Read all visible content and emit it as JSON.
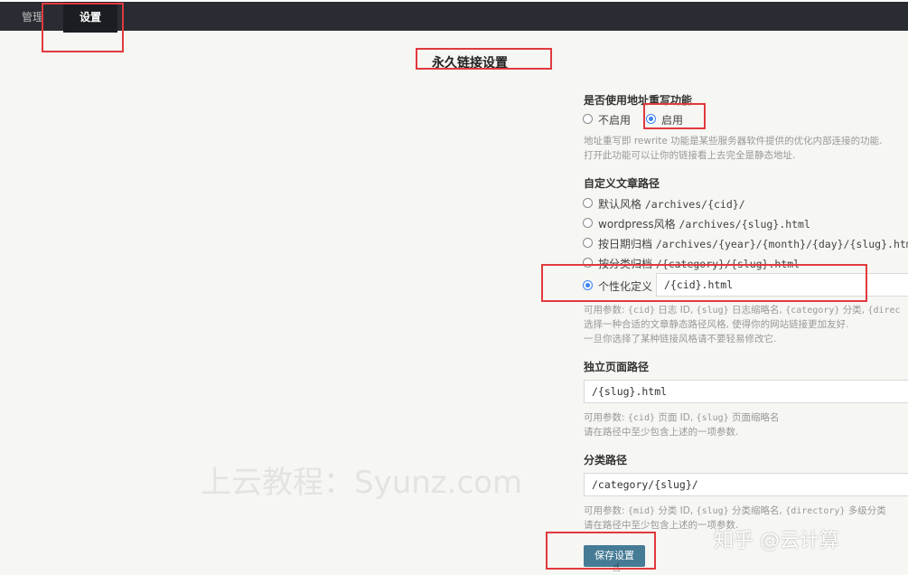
{
  "nav": {
    "manage": "管理",
    "settings": "设置"
  },
  "page_title": "永久链接设置",
  "rewrite": {
    "title": "是否使用地址重写功能",
    "off_label": "不启用",
    "on_label": "启用",
    "selected": "on",
    "desc_line1": "地址重写即 rewrite 功能是某些服务器软件提供的优化内部连接的功能.",
    "desc_line2": "打开此功能可以让你的链接看上去完全是静态地址."
  },
  "post_path": {
    "title": "自定义文章路径",
    "options": [
      {
        "label": "默认风格",
        "pattern": "/archives/{cid}/"
      },
      {
        "label": "wordpress风格",
        "pattern": "/archives/{slug}.html"
      },
      {
        "label": "按日期归档",
        "pattern": "/archives/{year}/{month}/{day}/{slug}.html"
      },
      {
        "label": "按分类归档",
        "pattern": "/{category}/{slug}.html"
      }
    ],
    "custom_label": "个性化定义",
    "custom_value": "/{cid}.html",
    "selected": "custom",
    "desc_prefix": "可用参数: ",
    "desc_p1": "{cid}",
    "desc_t1": " 日志 ID, ",
    "desc_p2": "{slug}",
    "desc_t2": " 日志缩略名, ",
    "desc_p3": "{category}",
    "desc_t3": " 分类, ",
    "desc_p4": "{direc",
    "desc_line2": "选择一种合适的文章静态路径风格, 使得你的网站链接更加友好.",
    "desc_line3": "一旦你选择了某种链接风格请不要轻易修改它."
  },
  "page_path": {
    "title": "独立页面路径",
    "value": "/{slug}.html",
    "desc_prefix": "可用参数: ",
    "desc_p1": "{cid}",
    "desc_t1": " 页面 ID, ",
    "desc_p2": "{slug}",
    "desc_t2": " 页面缩略名",
    "desc_line2": "请在路径中至少包含上述的一项参数."
  },
  "category_path": {
    "title": "分类路径",
    "value": "/category/{slug}/",
    "desc_prefix": "可用参数: ",
    "desc_p1": "{mid}",
    "desc_t1": " 分类 ID, ",
    "desc_p2": "{slug}",
    "desc_t2": " 分类缩略名, ",
    "desc_p3": "{directory}",
    "desc_t3": " 多级分类",
    "desc_line2": "请在路径中至少包含上述的一项参数."
  },
  "save_label": "保存设置",
  "watermarks": {
    "left": "上云教程：Syunz.com",
    "right": "知乎 @云计算"
  },
  "colors": {
    "topbar": "#292d33",
    "accent": "#467b96",
    "annotation": "#e03a3e",
    "radio": "#3b82f6"
  }
}
